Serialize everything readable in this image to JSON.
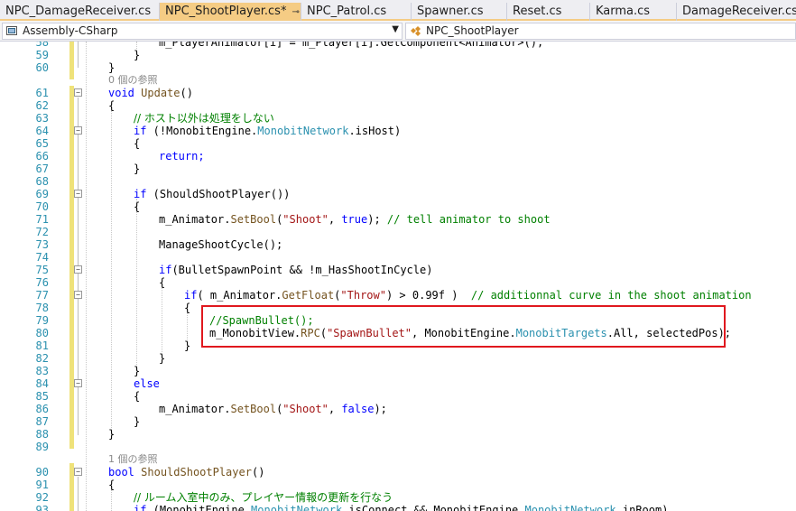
{
  "tabs": [
    {
      "label": "NPC_DamageReceiver.cs",
      "active": false
    },
    {
      "label": "NPC_ShootPlayer.cs*",
      "active": true
    },
    {
      "label": "NPC_Patrol.cs",
      "active": false
    },
    {
      "label": "Spawner.cs",
      "active": false
    },
    {
      "label": "Reset.cs",
      "active": false
    },
    {
      "label": "Karma.cs",
      "active": false
    },
    {
      "label": "DamageReceiver.cs",
      "active": false
    }
  ],
  "tab_pin_glyph": "⊸",
  "tab_close_glyph": "×",
  "navbar": {
    "project": "Assembly-CSharp",
    "class": "NPC_ShootPlayer"
  },
  "references": {
    "update": "0 個の参照",
    "should_shoot": "1 個の参照"
  },
  "line_numbers": [
    "58",
    "59",
    "60",
    "61",
    "62",
    "63",
    "64",
    "65",
    "66",
    "67",
    "68",
    "69",
    "70",
    "71",
    "72",
    "73",
    "74",
    "75",
    "76",
    "77",
    "78",
    "79",
    "80",
    "81",
    "82",
    "83",
    "84",
    "85",
    "86",
    "87",
    "88",
    "89",
    "90",
    "91",
    "92",
    "93"
  ],
  "code": {
    "l58": "m_PlayerAnimator[i] = m_Player[i].GetComponent<Animator>();",
    "l59": "}",
    "l60": "}",
    "l61_kw": "void",
    "l61_fn": "Update",
    "l61_rest": "()",
    "l62": "{",
    "l63": "// ホスト以外は処理をしない",
    "l64_kw": "if",
    "l64_a": " (!MonobitEngine.",
    "l64_ty": "MonobitNetwork",
    "l64_b": ".isHost)",
    "l65": "{",
    "l66": "return;",
    "l67": "}",
    "l69_kw": "if",
    "l69_rest": " (ShouldShootPlayer())",
    "l70": "{",
    "l71_a": "m_Animator.",
    "l71_fn": "SetBool",
    "l71_b": "(",
    "l71_st": "\"Shoot\"",
    "l71_c": ", ",
    "l71_kw": "true",
    "l71_d": "); ",
    "l71_cm": "// tell animator to shoot",
    "l73": "ManageShootCycle();",
    "l75_kw": "if",
    "l75_rest": "(BulletSpawnPoint && !m_HasShootInCycle)",
    "l76": "{",
    "l77_kw": "if",
    "l77_a": "( m_Animator.",
    "l77_fn": "GetFloat",
    "l77_b": "(",
    "l77_st": "\"Throw\"",
    "l77_c": ") > 0.99f )  ",
    "l77_cm": "// additionnal curve in the shoot animation",
    "l78": "{",
    "l79_cm": "//SpawnBullet();",
    "l80_a": "m_MonobitView.",
    "l80_fn": "RPC",
    "l80_b": "(",
    "l80_st": "\"SpawnBullet\"",
    "l80_c": ", MonobitEngine.",
    "l80_ty": "MonobitTargets",
    "l80_d": ".All, selectedPos);",
    "l81": "}",
    "l82": "}",
    "l83": "}",
    "l84_kw": "else",
    "l85": "{",
    "l86_a": "m_Animator.",
    "l86_fn": "SetBool",
    "l86_b": "(",
    "l86_st": "\"Shoot\"",
    "l86_c": ", ",
    "l86_kw": "false",
    "l86_d": ");",
    "l87": "}",
    "l88": "}",
    "l90_kw": "bool",
    "l90_fn": "ShouldShootPlayer",
    "l90_rest": "()",
    "l91": "{",
    "l92": "// ルーム入室中のみ、プレイヤー情報の更新を行なう",
    "l93_kw": "if",
    "l93_a": " (MonobitEngine.",
    "l93_ty": "MonobitNetwork",
    "l93_b": ".isConnect && MonobitEngine.",
    "l93_ty2": "MonobitNetwork",
    "l93_c": ".inRoom)"
  },
  "colors": {
    "keyword": "#0000ff",
    "type": "#2b91af",
    "comment": "#008000",
    "string": "#a31515",
    "highlight_box": "#e0181e",
    "active_tab": "#f5cc84"
  }
}
